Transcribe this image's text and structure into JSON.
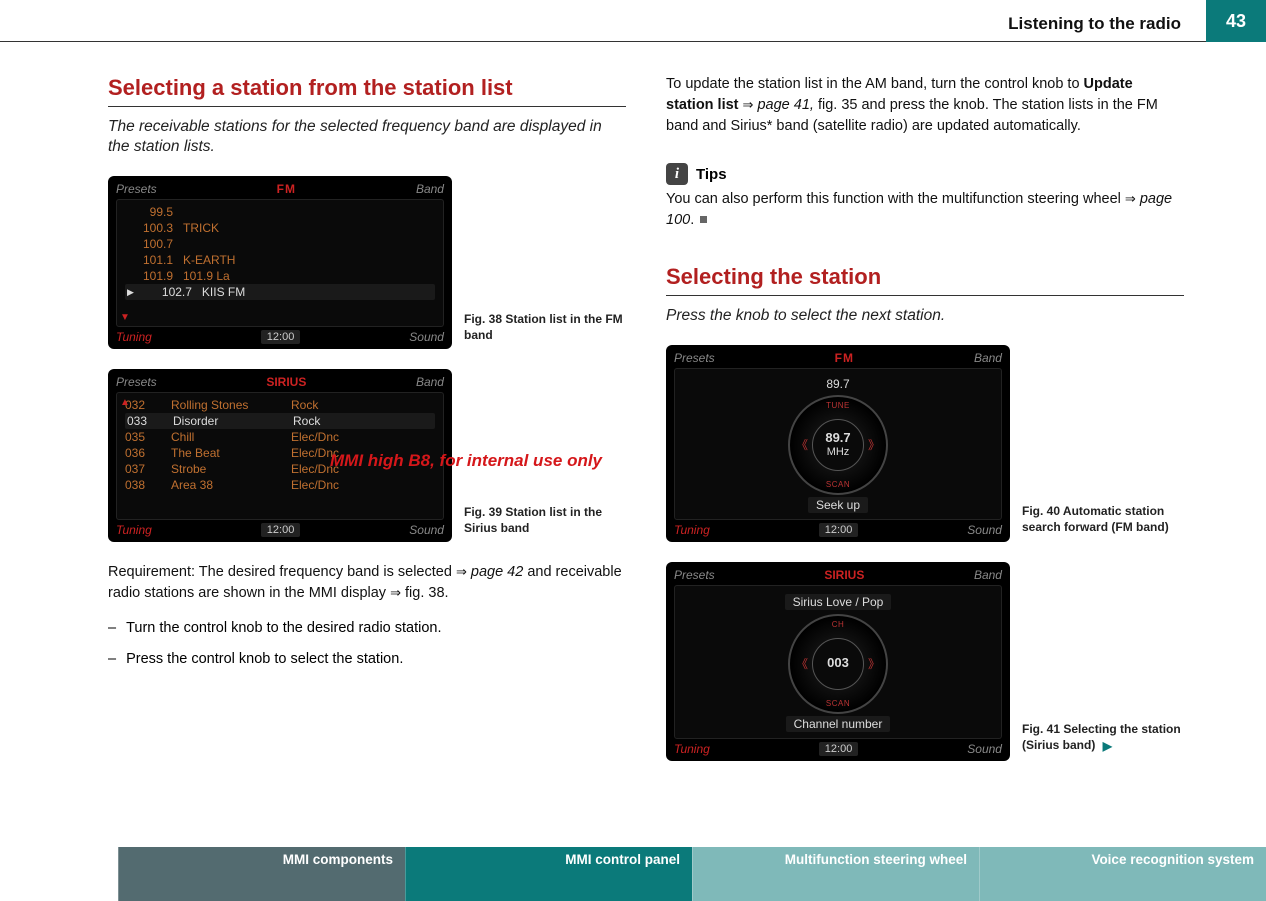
{
  "header": {
    "title": "Listening to the radio",
    "page_number": "43"
  },
  "watermark": "MMI high B8, for internal use only",
  "left": {
    "heading": "Selecting a station from the station list",
    "intro": "The receivable stations for the selected frequency band are displayed in the station lists.",
    "fig38": {
      "caption": "Fig. 38  Station list in the FM band",
      "topbar_left": "Presets",
      "band": "FM",
      "topbar_right": "Band",
      "rows": [
        {
          "freq": "99.5",
          "name": ""
        },
        {
          "freq": "100.3",
          "name": "TRICK"
        },
        {
          "freq": "100.7",
          "name": ""
        },
        {
          "freq": "101.1",
          "name": "K-EARTH"
        },
        {
          "freq": "101.9",
          "name": "101.9 La"
        },
        {
          "freq": "102.7",
          "name": "KIIS FM",
          "hl": true
        }
      ],
      "time": "12:00",
      "bottom_left": "Tuning",
      "bottom_right": "Sound"
    },
    "fig39": {
      "caption": "Fig. 39  Station list in the Sirius band",
      "topbar_left": "Presets",
      "band": "SIRIUS",
      "topbar_right": "Band",
      "rows": [
        {
          "ch": "032",
          "name": "Rolling Stones",
          "cat": "Rock"
        },
        {
          "ch": "033",
          "name": "Disorder",
          "cat": "Rock",
          "hl": true
        },
        {
          "ch": "035",
          "name": "Chill",
          "cat": "Elec/Dnc"
        },
        {
          "ch": "036",
          "name": "The Beat",
          "cat": "Elec/Dnc"
        },
        {
          "ch": "037",
          "name": "Strobe",
          "cat": "Elec/Dnc"
        },
        {
          "ch": "038",
          "name": "Area 38",
          "cat": "Elec/Dnc"
        }
      ],
      "time": "12:00",
      "bottom_left": "Tuning",
      "bottom_right": "Sound"
    },
    "req_pre": "Requirement: The desired frequency band is selected ",
    "req_ref1": "page 42",
    "req_mid": " and receivable radio stations are shown in the MMI display ",
    "req_ref2": "fig. 38.",
    "step1": "Turn the control knob to the desired radio station.",
    "step2": "Press the control knob to select the station."
  },
  "right": {
    "para1_pre": "To update the station list in the AM band, turn the control knob to ",
    "para1_bold": "Update station list",
    "para1_ref": "page 41,",
    "para1_post": " fig. 35 and press the knob. The station lists in the FM band and Sirius* band (satellite radio) are updated automatically.",
    "tips_label": "Tips",
    "tips_text_pre": "You can also perform this function with the multifunction steering wheel ",
    "tips_ref": "page 100",
    "heading2": "Selecting the station",
    "intro2": "Press the knob to select the next station.",
    "fig40": {
      "caption": "Fig. 40  Automatic station search forward (FM band)",
      "topbar_left": "Presets",
      "band": "FM",
      "topbar_right": "Band",
      "top_freq": "89.7",
      "dial_big": "89.7",
      "dial_unit": "MHz",
      "dial_top": "TUNE",
      "dial_bottom": "SCAN",
      "seek": "Seek up",
      "time": "12:00",
      "bottom_left": "Tuning",
      "bottom_right": "Sound"
    },
    "fig41": {
      "caption": "Fig. 41  Selecting the station (Sirius band)",
      "topbar_left": "Presets",
      "band": "SIRIUS",
      "topbar_right": "Band",
      "top_text": "Sirius Love / Pop",
      "dial_big": "003",
      "dial_top": "CH",
      "dial_bottom": "SCAN",
      "seek": "Channel number",
      "time": "12:00",
      "bottom_left": "Tuning",
      "bottom_right": "Sound"
    }
  },
  "footer": {
    "tab1": "MMI components",
    "tab2": "MMI control panel",
    "tab3": "Multifunction steering wheel",
    "tab4": "Voice recognition system"
  }
}
